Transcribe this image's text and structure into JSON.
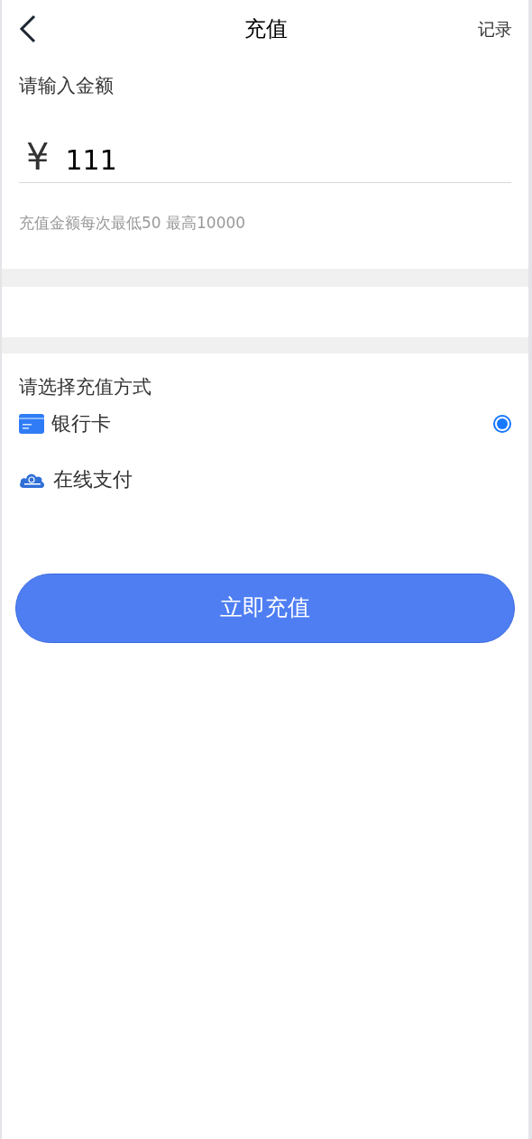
{
  "header": {
    "title": "充值",
    "action": "记录"
  },
  "amount": {
    "label": "请输入金额",
    "currency": "¥",
    "value": "111",
    "hint": "充值金额每次最低50 最高10000"
  },
  "methods": {
    "title": "请选择充值方式",
    "items": [
      {
        "kind": "bank",
        "label": "银行卡",
        "selected": true
      },
      {
        "kind": "online",
        "label": "在线支付",
        "selected": false
      }
    ]
  },
  "submit": "立即充值"
}
